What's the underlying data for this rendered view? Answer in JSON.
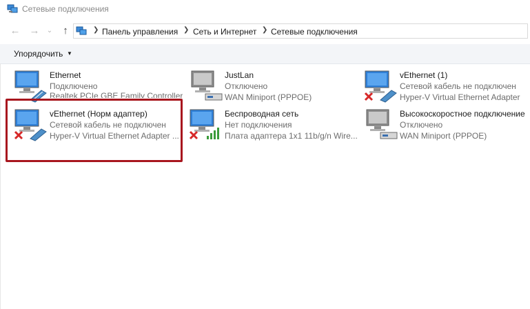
{
  "window": {
    "title": "Сетевые подключения"
  },
  "address": {
    "crumbs": [
      "Панель управления",
      "Сеть и Интернет",
      "Сетевые подключения"
    ]
  },
  "toolbar": {
    "organize_label": "Упорядочить"
  },
  "connections": [
    {
      "name": "Ethernet",
      "status": "Подключено",
      "device": "Realtek PCIe GBE Family Controller",
      "icon": "ethernet-connected-icon"
    },
    {
      "name": "JustLan",
      "status": "Отключено",
      "device": "WAN Miniport (PPPOE)",
      "icon": "wan-disconnected-icon"
    },
    {
      "name": "vEthernet (1)",
      "status": "Сетевой кабель не подключен",
      "device": "Hyper-V Virtual Ethernet Adapter",
      "icon": "ethernet-cable-unplugged-icon"
    },
    {
      "name": "vEthernet (Норм адаптер)",
      "status": "Сетевой кабель не подключен",
      "device": "Hyper-V Virtual Ethernet Adapter ...",
      "icon": "ethernet-cable-unplugged-icon"
    },
    {
      "name": "Беспроводная сеть",
      "status": "Нет подключения",
      "device": "Плата адаптера 1x1 11b/g/n Wire...",
      "icon": "wireless-disconnected-icon"
    },
    {
      "name": "Высокоскоростное подключение",
      "status": "Отключено",
      "device": "WAN Miniport (PPPOE)",
      "icon": "wan-disconnected-icon"
    }
  ],
  "colors": {
    "highlight_border": "#a8161e",
    "command_bar_bg": "#f3f5f8",
    "monitor_blue": "#2f7fd6",
    "error_red": "#d62828",
    "signal_green": "#3a9b3a"
  }
}
